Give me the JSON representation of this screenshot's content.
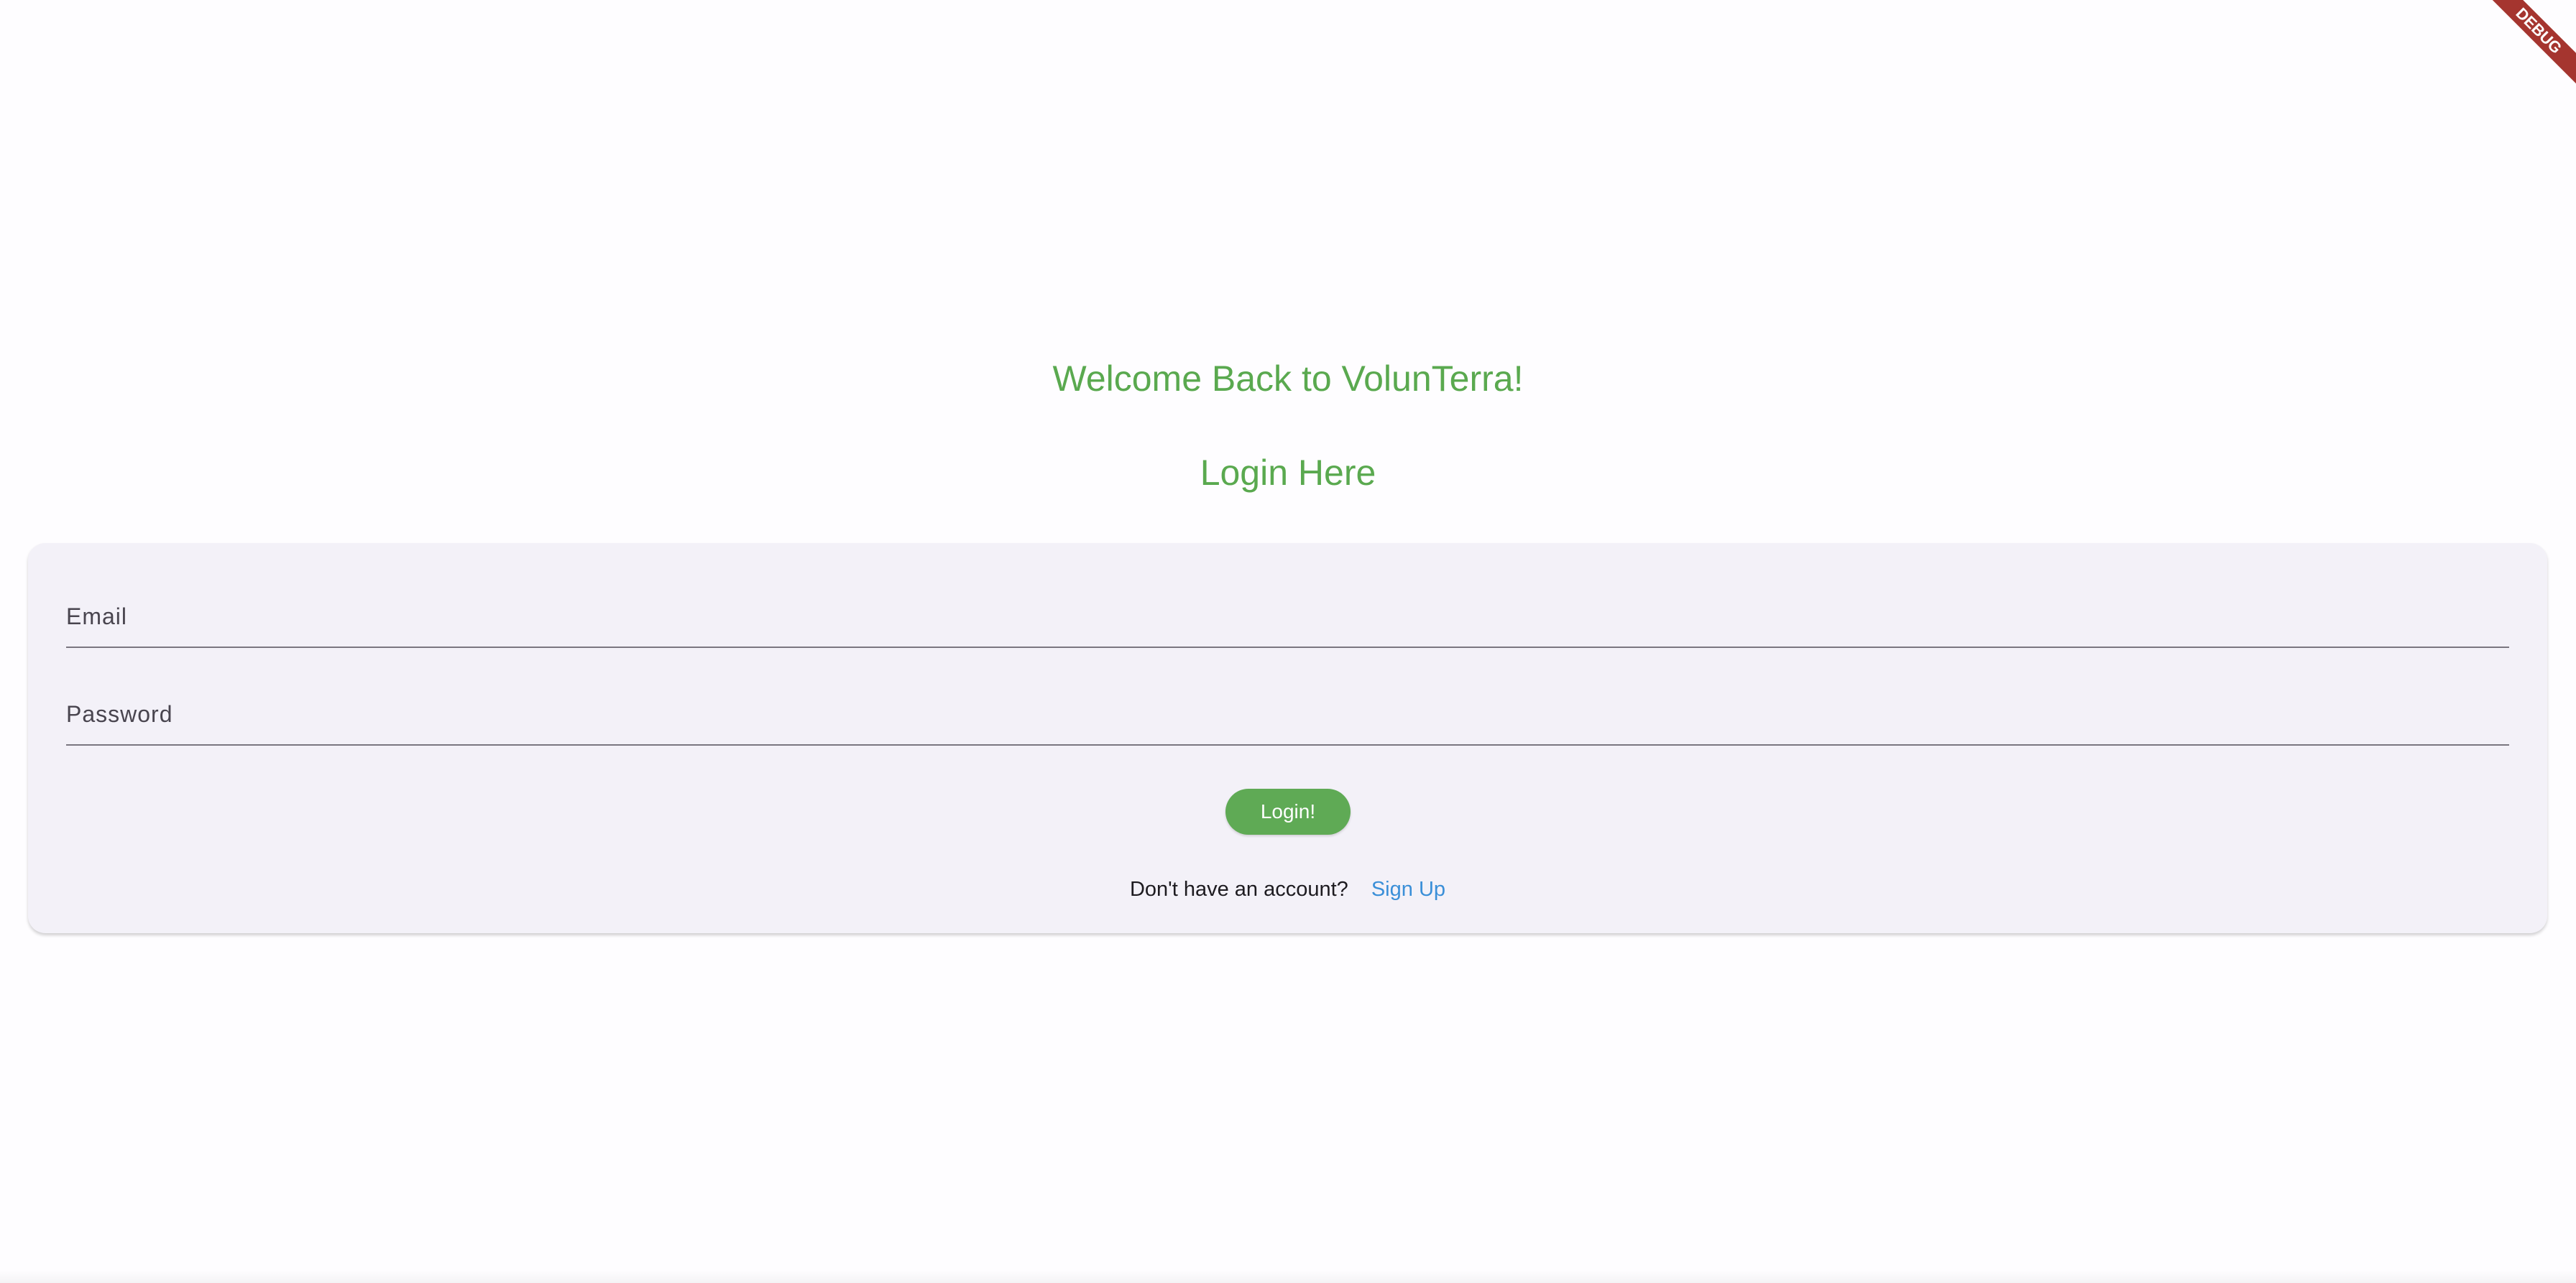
{
  "debug_banner": {
    "label": "DEBUG"
  },
  "header": {
    "welcome": "Welcome Back to VolunTerra!",
    "subtitle": "Login Here"
  },
  "form": {
    "email": {
      "placeholder": "Email",
      "value": ""
    },
    "password": {
      "placeholder": "Password",
      "value": ""
    },
    "login_label": "Login!",
    "signup_prompt": "Don't have an account?",
    "signup_link": "Sign Up"
  },
  "colors": {
    "accent_green": "#5aa94f",
    "button_green": "#5faa55",
    "link_blue": "#3a8fd8",
    "card_bg": "#f3f1f8",
    "debug_red": "#a5352f"
  }
}
